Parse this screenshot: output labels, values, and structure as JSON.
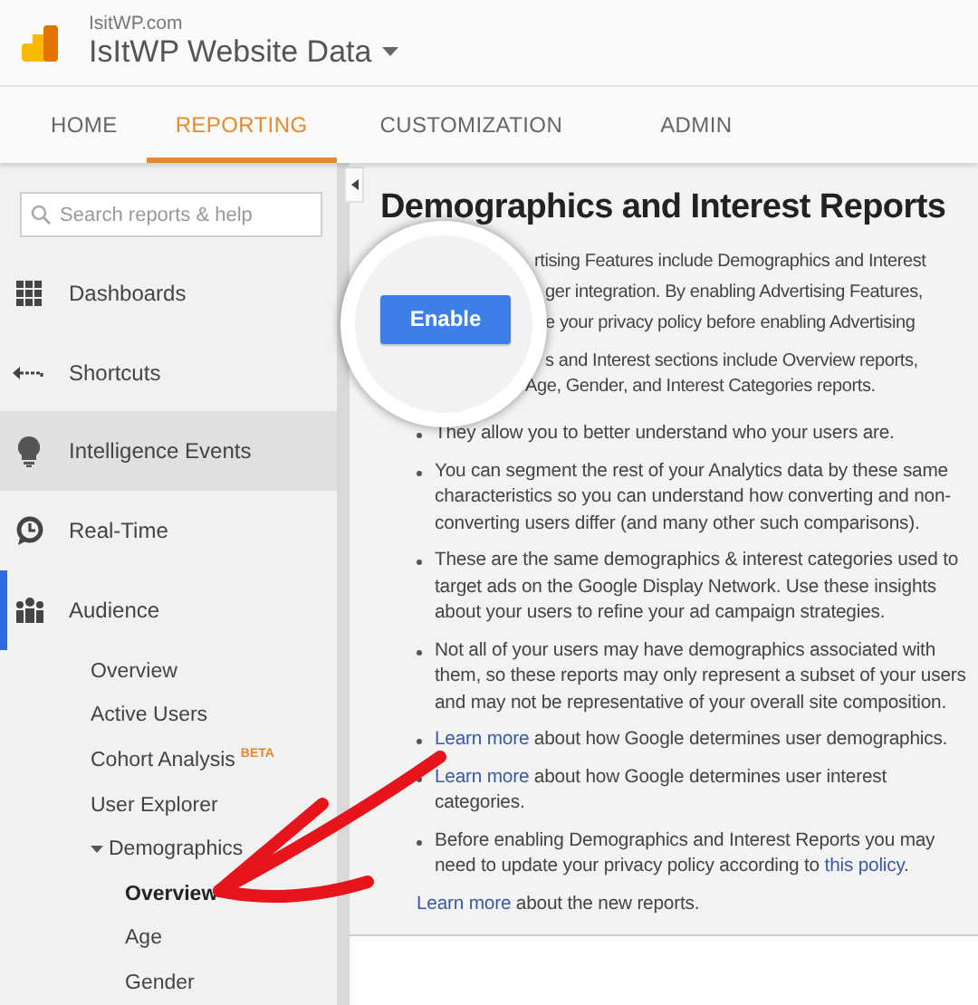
{
  "header": {
    "site": "IsitWP.com",
    "property": "IsItWP Website Data"
  },
  "nav_tabs": [
    {
      "label": "HOME",
      "selected": false
    },
    {
      "label": "REPORTING",
      "selected": true
    },
    {
      "label": "CUSTOMIZATION",
      "selected": false
    },
    {
      "label": "ADMIN",
      "selected": false
    }
  ],
  "sidebar": {
    "search": {
      "placeholder": "Search reports & help"
    },
    "items": [
      {
        "label": "Dashboards",
        "selected": false,
        "highlighted": false
      },
      {
        "label": "Shortcuts",
        "selected": false,
        "highlighted": false
      },
      {
        "label": "Intelligence Events",
        "selected": false,
        "highlighted": true
      },
      {
        "label": "Real-Time",
        "selected": false,
        "highlighted": false
      },
      {
        "label": "Audience",
        "selected": true,
        "highlighted": false,
        "children": [
          {
            "label": "Overview",
            "selected": false
          },
          {
            "label": "Active Users",
            "selected": false
          },
          {
            "label": "Cohort Analysis",
            "badge": "BETA",
            "selected": false
          },
          {
            "label": "User Explorer",
            "selected": false
          },
          {
            "label": "Demographics",
            "selected": false,
            "expanded": true,
            "children": [
              {
                "label": "Overview",
                "selected": true
              },
              {
                "label": "Age",
                "selected": false
              },
              {
                "label": "Gender",
                "selected": false
              }
            ]
          }
        ]
      }
    ]
  },
  "main": {
    "title": "Demographics and Interest Reports",
    "intro_lines": [
      "rtising Features include Demographics and Interest",
      "ger integration. By enabling Advertising Features,",
      "e your privacy policy before enabling Advertising"
    ],
    "intro_lines_2": [
      "s and Interest sections include Overview reports,",
      "Age, Gender, and Interest Categories reports."
    ],
    "bullets": [
      {
        "segments": [
          {
            "kind": "text",
            "text": "They allow you to better understand who your users are."
          }
        ]
      },
      {
        "segments": [
          {
            "kind": "text",
            "text": "You can segment the rest of your Analytics data by these same characteristics so you can understand how converting and non-converting users differ (and many other such comparisons)."
          }
        ]
      },
      {
        "segments": [
          {
            "kind": "text",
            "text": "These are the same demographics & interest categories used to target ads on the Google Display Network. Use these insights about your users to refine your ad campaign strategies."
          }
        ]
      },
      {
        "segments": [
          {
            "kind": "text",
            "text": "Not all of your users may have demographics associated with them, so these reports may only represent a subset of your users and may not be representative of your overall site composition."
          }
        ]
      },
      {
        "segments": [
          {
            "kind": "link",
            "text": "Learn more"
          },
          {
            "kind": "text",
            "text": " about how Google determines user demographics."
          }
        ]
      },
      {
        "segments": [
          {
            "kind": "link",
            "text": "Learn more"
          },
          {
            "kind": "text",
            "text": " about how Google determines user interest categories."
          }
        ]
      },
      {
        "segments": [
          {
            "kind": "text",
            "text": "Before enabling Demographics and Interest Reports you may need to update your privacy policy according to "
          },
          {
            "kind": "link",
            "text": "this policy"
          },
          {
            "kind": "text",
            "text": "."
          }
        ]
      }
    ],
    "footer_note": {
      "segments": [
        {
          "kind": "link",
          "text": "Learn more"
        },
        {
          "kind": "text",
          "text": " about the new reports."
        }
      ]
    },
    "enable_button": {
      "label": "Enable"
    }
  }
}
